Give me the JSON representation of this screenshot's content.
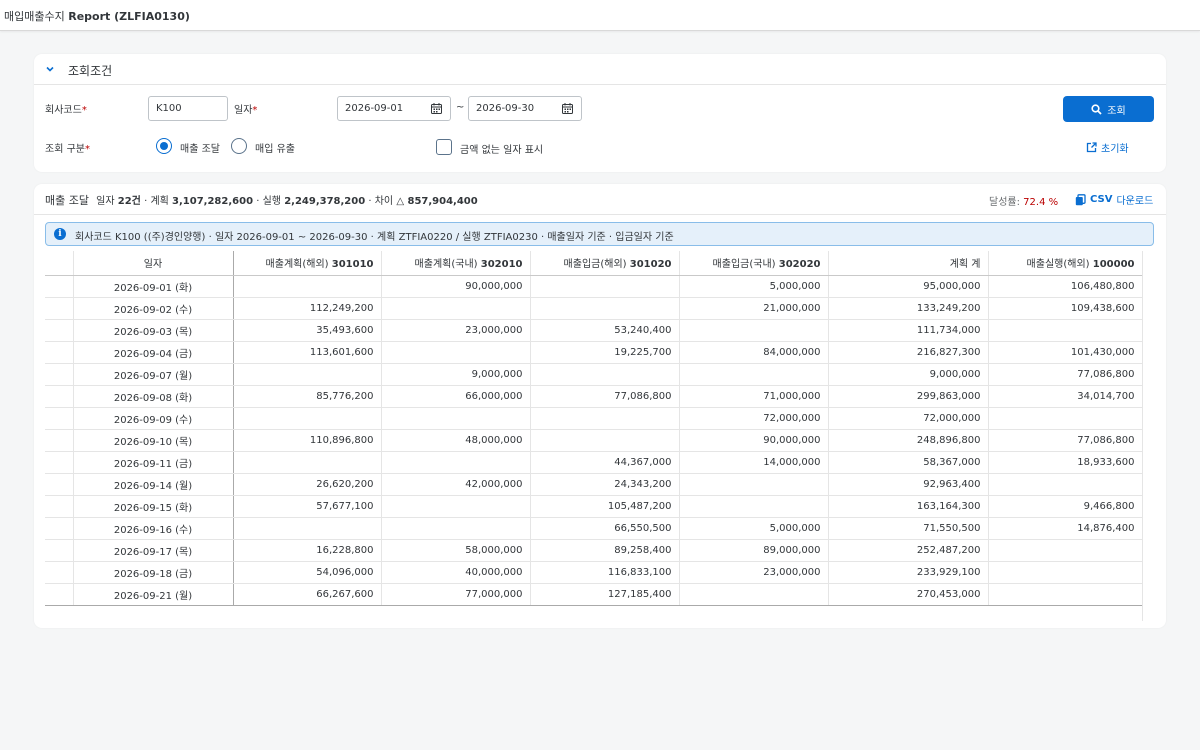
{
  "app": {
    "title_prefix": "매입매출수지",
    "title_main": "Report (ZLFIA0130)"
  },
  "filter": {
    "section_title": "조회조건",
    "company_label": "회사코드",
    "company_value": "K100",
    "date_label": "일자",
    "date_from": "2026-09-01",
    "date_sep": "~",
    "date_to": "2026-09-30",
    "type_label": "조회 구분",
    "required_mark": "*",
    "radio_sales": "매출 조달",
    "radio_purchase": "매입 유출",
    "checkbox_label": "금액 없는 일자 표시",
    "search_label": "조회",
    "reset_label": "초기화"
  },
  "summary": {
    "title": "매출 조달",
    "count_label": "일자",
    "count_value": "22건",
    "sep1": "·",
    "plan_label": "계획",
    "plan_value": "3,107,282,600",
    "sep2": "·",
    "actual_label": "실행",
    "actual_value": "2,249,378,200",
    "sep3": "·",
    "diff_label": "차이",
    "diff_value": "△ 857,904,400",
    "rate_label": "달성률:",
    "rate_value": "72.4 %",
    "csv_bold": "CSV",
    "csv_label": "다운로드"
  },
  "info": {
    "text": "회사코드 K100 ((주)경인양행) · 일자 2026-09-01 ~ 2026-09-30 · 계획 ZTFIA0220 / 실행 ZTFIA0230 · 매출일자 기준 · 입금일자 기준"
  },
  "table": {
    "columns": [
      {
        "prefix": "일자",
        "code": ""
      },
      {
        "prefix": "매출계획(해외)",
        "code": "301010"
      },
      {
        "prefix": "매출계획(국내)",
        "code": "302010"
      },
      {
        "prefix": "매출입금(해외)",
        "code": "301020"
      },
      {
        "prefix": "매출입금(국내)",
        "code": "302020"
      },
      {
        "prefix": "계획 계",
        "code": ""
      },
      {
        "prefix": "매출실행(해외)",
        "code": "100000"
      }
    ],
    "rows": [
      [
        "2026-09-01 (화)",
        "",
        "90,000,000",
        "",
        "5,000,000",
        "95,000,000",
        "106,480,800"
      ],
      [
        "2026-09-02 (수)",
        "112,249,200",
        "",
        "",
        "21,000,000",
        "133,249,200",
        "109,438,600"
      ],
      [
        "2026-09-03 (목)",
        "35,493,600",
        "23,000,000",
        "53,240,400",
        "",
        "111,734,000",
        ""
      ],
      [
        "2026-09-04 (금)",
        "113,601,600",
        "",
        "19,225,700",
        "84,000,000",
        "216,827,300",
        "101,430,000"
      ],
      [
        "2026-09-07 (월)",
        "",
        "9,000,000",
        "",
        "",
        "9,000,000",
        "77,086,800"
      ],
      [
        "2026-09-08 (화)",
        "85,776,200",
        "66,000,000",
        "77,086,800",
        "71,000,000",
        "299,863,000",
        "34,014,700"
      ],
      [
        "2026-09-09 (수)",
        "",
        "",
        "",
        "72,000,000",
        "72,000,000",
        ""
      ],
      [
        "2026-09-10 (목)",
        "110,896,800",
        "48,000,000",
        "",
        "90,000,000",
        "248,896,800",
        "77,086,800"
      ],
      [
        "2026-09-11 (금)",
        "",
        "",
        "44,367,000",
        "14,000,000",
        "58,367,000",
        "18,933,600"
      ],
      [
        "2026-09-14 (월)",
        "26,620,200",
        "42,000,000",
        "24,343,200",
        "",
        "92,963,400",
        ""
      ],
      [
        "2026-09-15 (화)",
        "57,677,100",
        "",
        "105,487,200",
        "",
        "163,164,300",
        "9,466,800"
      ],
      [
        "2026-09-16 (수)",
        "",
        "",
        "66,550,500",
        "5,000,000",
        "71,550,500",
        "14,876,400"
      ],
      [
        "2026-09-17 (목)",
        "16,228,800",
        "58,000,000",
        "89,258,400",
        "89,000,000",
        "252,487,200",
        ""
      ],
      [
        "2026-09-18 (금)",
        "54,096,000",
        "40,000,000",
        "116,833,100",
        "23,000,000",
        "233,929,100",
        ""
      ],
      [
        "2026-09-21 (월)",
        "66,267,600",
        "77,000,000",
        "127,185,400",
        "",
        "270,453,000",
        ""
      ]
    ]
  },
  "colors": {
    "accent": "#0a6ed1",
    "required": "#bb0000",
    "info_bg": "#e5f0fa"
  }
}
